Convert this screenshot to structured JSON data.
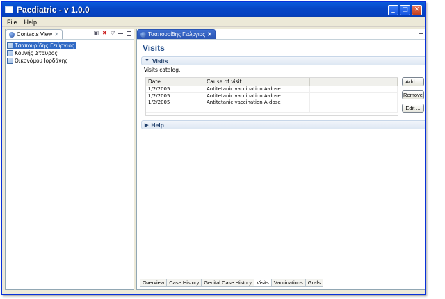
{
  "window": {
    "title": "Paediatric - v 1.0.0",
    "min_glyph": "_",
    "max_glyph": "□",
    "close_glyph": "✕"
  },
  "menu": [
    {
      "label": "File"
    },
    {
      "label": "Help"
    }
  ],
  "contacts_view": {
    "tab_label": "Contacts View",
    "close_glyph": "✕",
    "contacts": [
      {
        "name": "Τσαπουρίδης Γεώργιος",
        "selected": true
      },
      {
        "name": "Κουνής Σταύρος",
        "selected": false
      },
      {
        "name": "Οικονόμου Ιορδάνης",
        "selected": false
      }
    ]
  },
  "editor": {
    "tab_label": "Τσαπουρίδης Γεώργιος",
    "close_glyph": "✕",
    "form_title": "Visits",
    "visits_section": {
      "title": "Visits",
      "description": "Visits catalog.",
      "columns": {
        "date": "Date",
        "cause": "Cause of visit"
      },
      "rows": [
        {
          "date": "1/2/2005",
          "cause": "Antitetanic vaccination A-dose"
        },
        {
          "date": "1/2/2005",
          "cause": "Antitetanic vaccination A-dose"
        },
        {
          "date": "1/2/2005",
          "cause": "Antitetanic vaccination A-dose"
        }
      ],
      "buttons": {
        "add": "Add ...",
        "remove": "Remove",
        "edit": "Edit ..."
      }
    },
    "help_section": {
      "title": "Help"
    },
    "bottom_tabs": [
      {
        "label": "Overview",
        "active": false
      },
      {
        "label": "Case History",
        "active": false
      },
      {
        "label": "Genital Case History",
        "active": false
      },
      {
        "label": "Visits",
        "active": true
      },
      {
        "label": "Vaccinations",
        "active": false
      },
      {
        "label": "Grafs",
        "active": false
      }
    ]
  },
  "colors": {
    "titlebar": "#0747c7",
    "selection": "#316ac5",
    "form_title": "#254f8c",
    "editor_tab": "#2a55b4"
  },
  "icons": {
    "app": "app-window-icon",
    "contact": "contact-icon",
    "view_tab": "globe-icon",
    "expanded": "triangle-down-icon",
    "collapsed": "triangle-right-icon"
  }
}
